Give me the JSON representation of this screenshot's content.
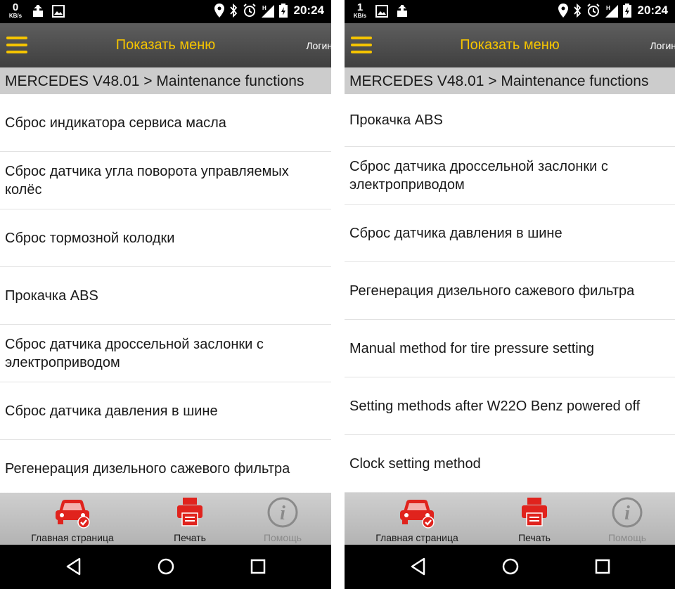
{
  "screens": [
    {
      "status": {
        "net_speed": "0",
        "net_unit": "KB/s",
        "time": "20:24"
      },
      "appbar": {
        "title": "Показать меню",
        "login": "Логин"
      },
      "breadcrumb": "MERCEDES V48.01 > Maintenance functions",
      "items": [
        "Сброс индикатора сервиса масла",
        "Сброс датчика угла поворота управляемых колёс",
        "Сброс тормозной колодки",
        "Прокачка ABS",
        "Сброс датчика дроссельной заслонки с электроприводом",
        "Сброс датчика давления в шине",
        "Регенерация дизельного сажевого фильтра"
      ],
      "tabs": {
        "home": "Главная страница",
        "print": "Печать",
        "help": "Помощь"
      }
    },
    {
      "status": {
        "net_speed": "1",
        "net_unit": "KB/s",
        "time": "20:24"
      },
      "appbar": {
        "title": "Показать меню",
        "login": "Логин"
      },
      "breadcrumb": "MERCEDES V48.01 > Maintenance functions",
      "items": [
        "Прокачка ABS",
        "Сброс датчика дроссельной заслонки с электроприводом",
        "Сброс датчика давления в шине",
        "Регенерация дизельного сажевого фильтра",
        "Manual method for tire pressure setting",
        "Setting methods after W22O Benz powered off",
        "Clock setting method"
      ],
      "tabs": {
        "home": "Главная страница",
        "print": "Печать",
        "help": "Помощь"
      }
    }
  ],
  "colors": {
    "accent": "#f5c400",
    "icon_red": "#e0231d",
    "disabled": "#8a8a8a"
  },
  "icons": [
    "location-icon",
    "bluetooth-icon",
    "alarm-icon",
    "signal-icon",
    "battery-icon",
    "car-icon",
    "printer-icon",
    "info-icon"
  ]
}
